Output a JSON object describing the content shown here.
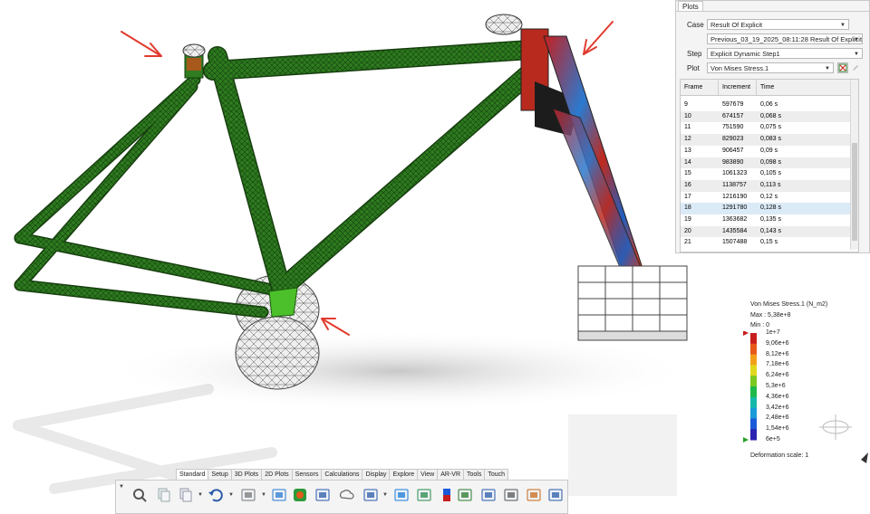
{
  "panel": {
    "tab_label": "Plots",
    "case_label": "Case",
    "case_value": "Result Of Explicit",
    "previous_value": "Previous_03_19_2025_08:11:28 Result Of Explicit",
    "step_label": "Step",
    "step_value": "Explicit Dynamic Step1",
    "plot_label": "Plot",
    "plot_value": "Von Mises Stress.1",
    "columns": [
      "Frame",
      "Increment",
      "Time"
    ],
    "rows": [
      {
        "frame": "9",
        "increment": "597679",
        "time": "0,06 s"
      },
      {
        "frame": "10",
        "increment": "674157",
        "time": "0,068 s"
      },
      {
        "frame": "11",
        "increment": "751590",
        "time": "0,075 s"
      },
      {
        "frame": "12",
        "increment": "829023",
        "time": "0,083 s"
      },
      {
        "frame": "13",
        "increment": "906457",
        "time": "0,09 s"
      },
      {
        "frame": "14",
        "increment": "983890",
        "time": "0,098 s"
      },
      {
        "frame": "15",
        "increment": "1061323",
        "time": "0,105 s"
      },
      {
        "frame": "16",
        "increment": "1138757",
        "time": "0,113 s"
      },
      {
        "frame": "17",
        "increment": "1216190",
        "time": "0,12 s"
      },
      {
        "frame": "18",
        "increment": "1291780",
        "time": "0,128 s"
      },
      {
        "frame": "19",
        "increment": "1363682",
        "time": "0,135 s"
      },
      {
        "frame": "20",
        "increment": "1435584",
        "time": "0,143 s"
      },
      {
        "frame": "21",
        "increment": "1507488",
        "time": "0,15 s"
      }
    ],
    "selected_frame": "18"
  },
  "legend": {
    "title": "Von Mises Stress.1 (N_m2)",
    "max": "Max : 5,38e+8",
    "min": "Min : 0",
    "ticks": [
      "1e+7",
      "9,06e+6",
      "8,12e+6",
      "7,18e+6",
      "6,24e+6",
      "5,3e+6",
      "4,36e+6",
      "3,42e+6",
      "2,48e+6",
      "1,54e+6",
      "6e+5"
    ],
    "deformation": "Deformation scale: 1",
    "colors": [
      "#c81e1e",
      "#e8581a",
      "#f2a01a",
      "#e0d81c",
      "#7bc820",
      "#1fb84a",
      "#18b8a8",
      "#1a9ad8",
      "#1a5ad8",
      "#2a22b0"
    ]
  },
  "toolbar": {
    "tabs": [
      "Standard",
      "Setup",
      "3D Plots",
      "2D Plots",
      "Sensors",
      "Calculations",
      "Display",
      "Explore",
      "View",
      "AR-VR",
      "Tools",
      "Touch"
    ],
    "active_tab": "Standard",
    "icons": [
      "zoom-icon",
      "copy-icon",
      "paste-icon",
      "undo-icon",
      "geometry-icon",
      "import-icon",
      "stress-plot-icon",
      "display-options-icon",
      "cloud-icon",
      "view-layout-icon",
      "contour-icon",
      "grid-icon",
      "colorbar-icon",
      "mesh-icon",
      "camera-icon",
      "sensor-icon",
      "settings-icon",
      "snapshot-icon"
    ]
  },
  "colors": {
    "frame_green": "#2e7d1e",
    "accent_red": "#e23b2e"
  }
}
